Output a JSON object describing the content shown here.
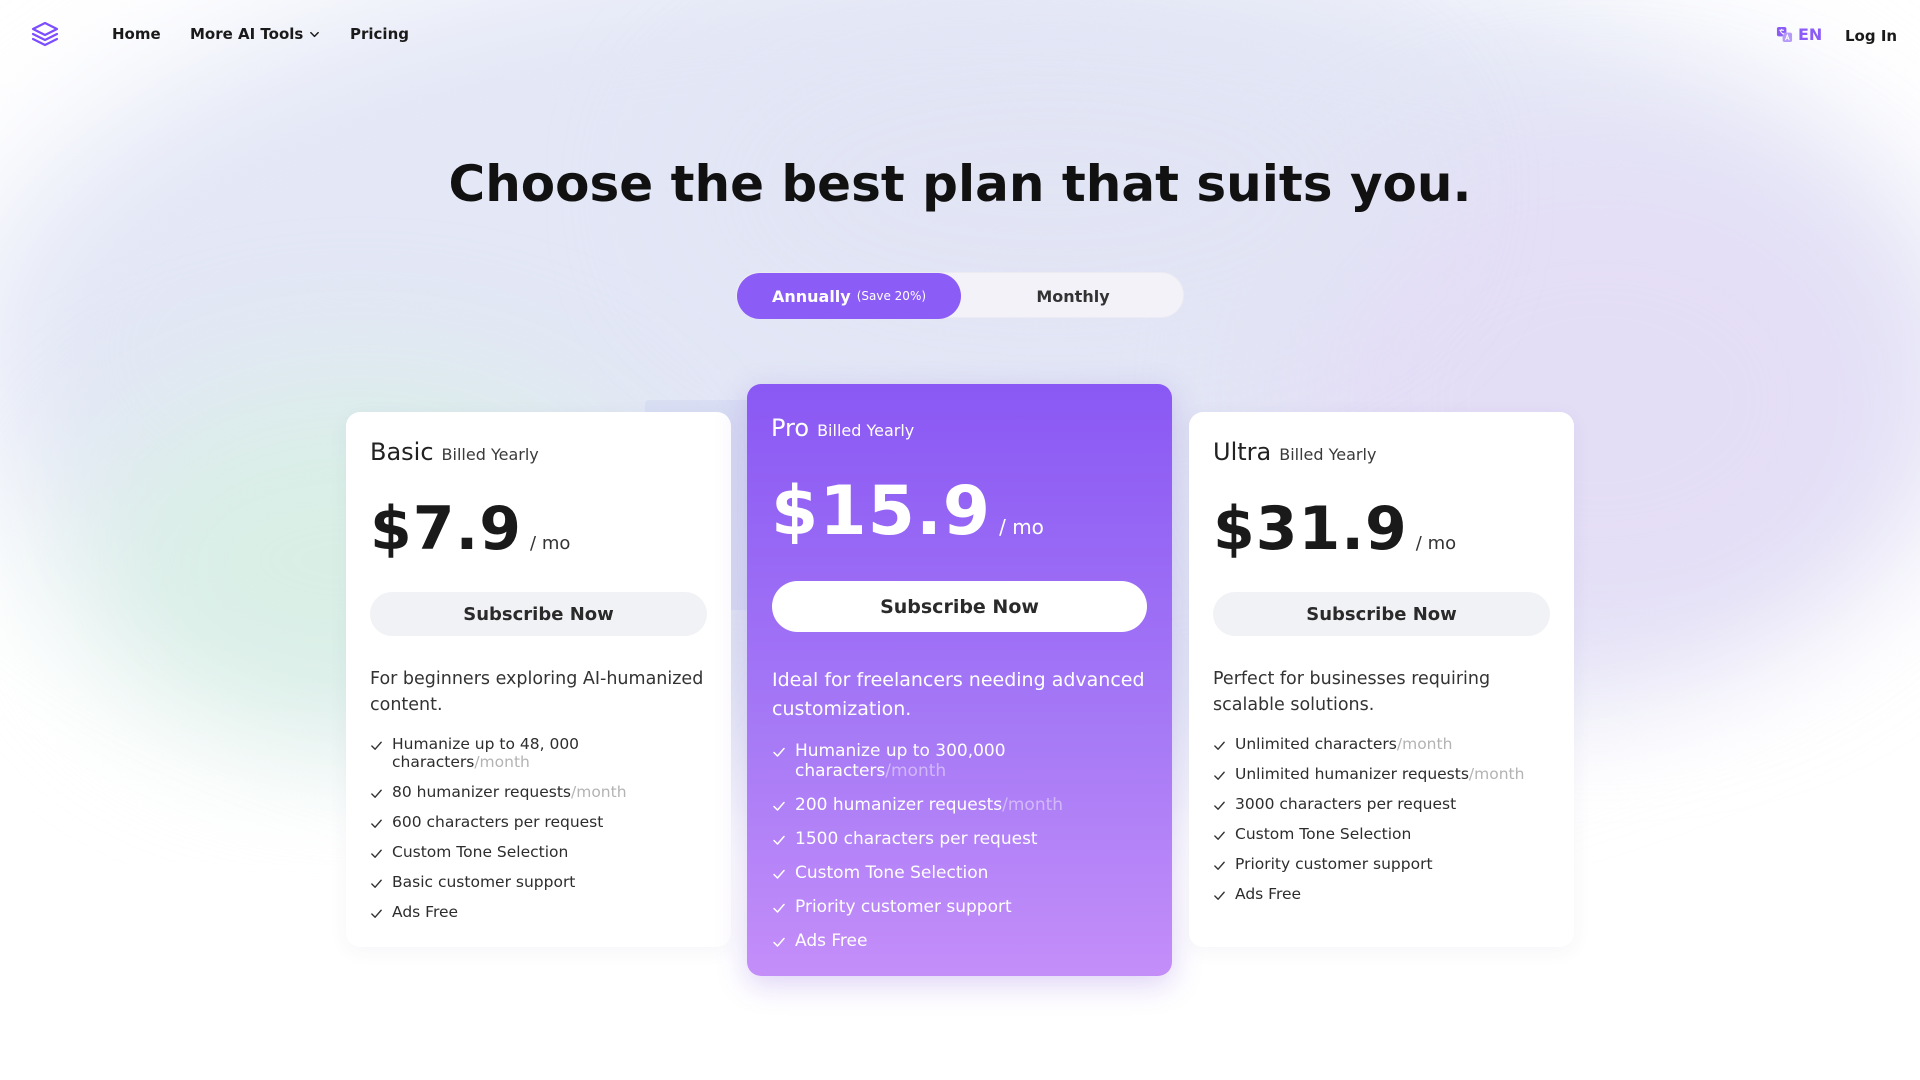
{
  "nav": {
    "home": "Home",
    "more_ai_tools": "More AI Tools",
    "pricing": "Pricing",
    "language": "EN",
    "login": "Log In"
  },
  "icons": {
    "logo": "layers-logo-icon",
    "dropdown": "chevron-down-icon",
    "language": "translate-icon",
    "check": "check-icon"
  },
  "colors": {
    "accent": "#8b5cf6",
    "pro_gradient_top": "#8a58f4",
    "pro_gradient_bottom": "#c48ef9"
  },
  "headline": "Choose the best plan that suits you.",
  "billing_toggle": {
    "annual_label": "Annually",
    "annual_save": "(Save 20%)",
    "monthly_label": "Monthly",
    "selected": "Annually"
  },
  "plans": [
    {
      "name": "Basic",
      "billing": "Billed Yearly",
      "price": "$7.9",
      "per": "/ mo",
      "cta": "Subscribe Now",
      "description": "For beginners exploring AI-humanized content.",
      "features": [
        {
          "text": "Humanize up to 48, 000 characters",
          "suffix": "/month"
        },
        {
          "text": "80 humanizer requests",
          "suffix": "/month"
        },
        {
          "text": "600 characters per request",
          "suffix": ""
        },
        {
          "text": "Custom Tone Selection",
          "suffix": ""
        },
        {
          "text": "Basic customer support",
          "suffix": ""
        },
        {
          "text": "Ads Free",
          "suffix": ""
        }
      ]
    },
    {
      "name": "Pro",
      "billing": "Billed Yearly",
      "price": "$15.9",
      "per": "/ mo",
      "cta": "Subscribe Now",
      "description": "Ideal for freelancers needing advanced customization.",
      "features": [
        {
          "text": "Humanize up to 300,000 characters",
          "suffix": "/month"
        },
        {
          "text": "200 humanizer requests",
          "suffix": "/month"
        },
        {
          "text": "1500 characters per request",
          "suffix": ""
        },
        {
          "text": "Custom Tone Selection",
          "suffix": ""
        },
        {
          "text": "Priority customer support",
          "suffix": ""
        },
        {
          "text": "Ads Free",
          "suffix": ""
        }
      ]
    },
    {
      "name": "Ultra",
      "billing": "Billed Yearly",
      "price": "$31.9",
      "per": "/ mo",
      "cta": "Subscribe Now",
      "description": "Perfect for businesses requiring scalable solutions.",
      "features": [
        {
          "text": "Unlimited characters",
          "suffix": "/month"
        },
        {
          "text": "Unlimited humanizer requests",
          "suffix": "/month"
        },
        {
          "text": "3000 characters per request",
          "suffix": ""
        },
        {
          "text": "Custom Tone Selection",
          "suffix": ""
        },
        {
          "text": "Priority customer support",
          "suffix": ""
        },
        {
          "text": "Ads Free",
          "suffix": ""
        }
      ]
    }
  ]
}
